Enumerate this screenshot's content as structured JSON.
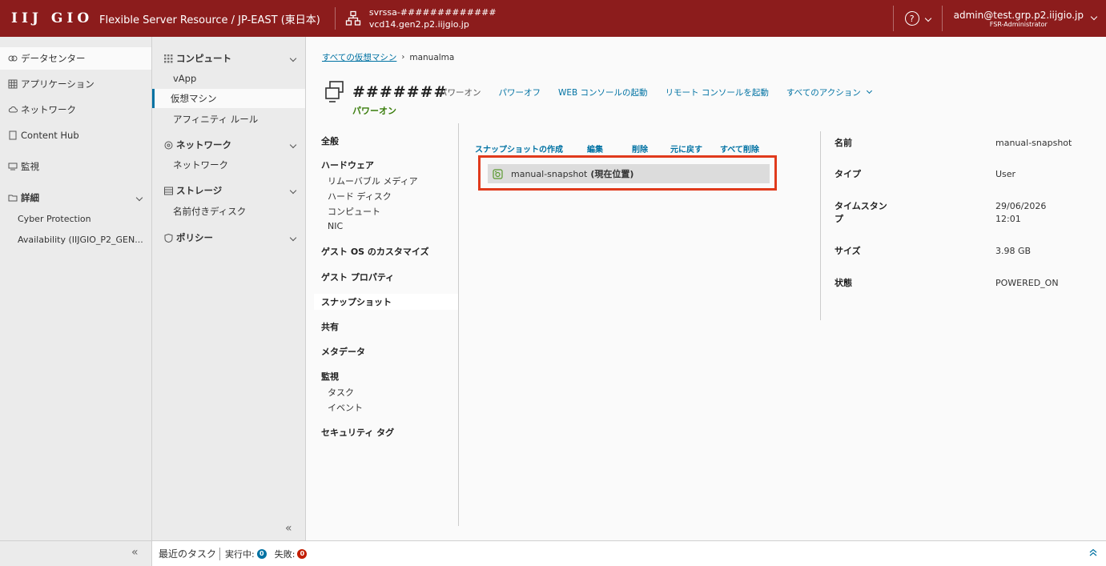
{
  "header": {
    "logo": "IIJ GIO",
    "app_title": "Flexible Server Resource / JP-EAST (東日本)",
    "org_name": "svrssa-#############",
    "org_host": "vcd14.gen2.p2.iijgio.jp",
    "help_symbol": "?",
    "user_email": "admin@test.grp.p2.iijgio.jp",
    "user_role": "FSR-Administrator",
    "color": "#8c1c1c"
  },
  "left_nav": {
    "items": [
      {
        "label": "データセンター",
        "icon": "datacenter-icon"
      },
      {
        "label": "アプリケーション",
        "icon": "apps-icon"
      },
      {
        "label": "ネットワーク",
        "icon": "cloud-icon"
      },
      {
        "label": "Content Hub",
        "icon": "doc-icon"
      },
      {
        "label": "監視",
        "icon": "monitor-icon"
      }
    ],
    "details_group": "詳細",
    "details_items": [
      "Cyber Protection",
      "Availability (IIJGIO_P2_GEN..."
    ],
    "collapse_symbol": "«"
  },
  "second_nav": {
    "compute_group": "コンピュート",
    "compute_items": [
      "vApp",
      "仮想マシン",
      "アフィニティ ルール"
    ],
    "network_group": "ネットワーク",
    "network_items": [
      "ネットワーク"
    ],
    "storage_group": "ストレージ",
    "storage_items": [
      "名前付きディスク"
    ],
    "policy_group": "ポリシー",
    "collapse_symbol": "«"
  },
  "main": {
    "breadcrumb_link": "すべての仮想マシン",
    "breadcrumb_current": "manualma",
    "vm_name": "#######",
    "vm_status": "パワーオン",
    "actions": [
      "パワーオン",
      "パワーオフ",
      "WEB コンソールの起動",
      "リモート コンソールを起動",
      "すべてのアクション"
    ]
  },
  "subnav": {
    "general": "全般",
    "hardware": "ハードウェア",
    "hardware_items": [
      "リムーバブル メディア",
      "ハード ディスク",
      "コンピュート",
      "NIC"
    ],
    "guest_os": "ゲスト OS のカスタマイズ",
    "guest_props": "ゲスト プロパティ",
    "snapshot": "スナップショット",
    "sharing": "共有",
    "metadata": "メタデータ",
    "monitor": "監視",
    "monitor_items": [
      "タスク",
      "イベント"
    ],
    "security_tags": "セキュリティ タグ"
  },
  "snapshot": {
    "actions": [
      "スナップショットの作成",
      "編集",
      "削除",
      "元に戻す",
      "すべて削除"
    ],
    "name": "manual-snapshot",
    "current": "(現在位置)"
  },
  "details": {
    "name_label": "名前",
    "name_value": "manual-snapshot",
    "type_label": "タイプ",
    "type_value": "User",
    "timestamp_label": "タイムスタンプ",
    "timestamp_date": "29/06/2026",
    "timestamp_time": "12:01",
    "size_label": "サイズ",
    "size_value": "3.98 GB",
    "state_label": "状態",
    "state_value": "POWERED_ON"
  },
  "bottom": {
    "recent_tasks": "最近のタスク",
    "running_label": "実行中:",
    "running_count": "0",
    "failed_label": "失敗:",
    "failed_count": "0",
    "running_color": "#0072a3",
    "failed_color": "#c21d00"
  }
}
